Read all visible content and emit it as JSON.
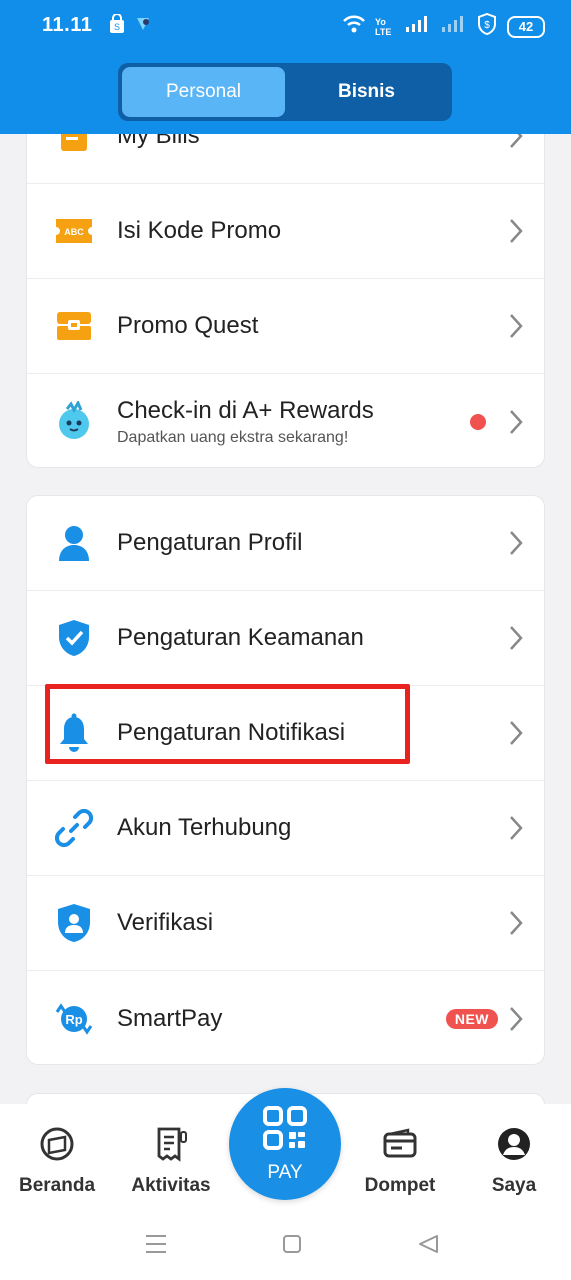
{
  "status_bar": {
    "time": "11.11",
    "network_label": "Yo LTE",
    "battery": "42"
  },
  "tabs": [
    {
      "label": "Personal",
      "active": true
    },
    {
      "label": "Bisnis",
      "active": false
    }
  ],
  "card1": {
    "items": [
      {
        "label": "My Bills",
        "icon": "bills-icon"
      },
      {
        "label": "Isi Kode Promo",
        "icon": "promo-code-icon",
        "icon_text": "ABC"
      },
      {
        "label": "Promo Quest",
        "icon": "treasure-chest-icon"
      },
      {
        "label": "Check-in di A+ Rewards",
        "sublabel": "Dapatkan uang ekstra sekarang!",
        "icon": "rewards-mascot-icon",
        "has_dot": true
      }
    ]
  },
  "card2": {
    "items": [
      {
        "label": "Pengaturan Profil",
        "icon": "person-icon"
      },
      {
        "label": "Pengaturan Keamanan",
        "icon": "shield-check-icon"
      },
      {
        "label": "Pengaturan Notifikasi",
        "icon": "bell-icon",
        "highlighted": true
      },
      {
        "label": "Akun Terhubung",
        "icon": "link-icon"
      },
      {
        "label": "Verifikasi",
        "icon": "verify-shield-icon"
      },
      {
        "label": "SmartPay",
        "icon": "smartpay-icon",
        "badge": "NEW",
        "icon_text": "Rp"
      }
    ]
  },
  "bottom_nav": {
    "items": [
      {
        "label": "Beranda",
        "icon": "home-wallet-icon"
      },
      {
        "label": "Aktivitas",
        "icon": "receipt-icon"
      },
      {
        "label": "Dompet",
        "icon": "wallet-icon"
      },
      {
        "label": "Saya",
        "icon": "profile-icon"
      }
    ],
    "pay_label": "PAY"
  },
  "colors": {
    "primary": "#118ee9",
    "segment_bg": "#0e5fa6",
    "segment_active": "#5ab5f6",
    "icon_orange": "#f5a112",
    "icon_blue": "#1a8fe6",
    "alert_red": "#f0534f",
    "highlight_red": "#e8221f"
  }
}
